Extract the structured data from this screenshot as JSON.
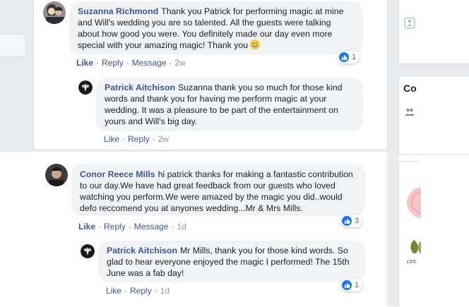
{
  "comments": [
    {
      "author": "Suzanna Richmond",
      "text": "Thank you Patrick for performing magic at mine and Will's wedding you are so talented. All the guests were talking about how good you were. You definitely made our day even more special with your amazing magic! Thank you",
      "emoji": "smiling-face-emoji",
      "actions": {
        "like": "Like",
        "reply": "Reply",
        "message": "Message",
        "time": "2w"
      },
      "reaction_count": "1",
      "reply": {
        "author": "Patrick Aitchison",
        "text": "Suzanna thank you so much for those kind words and thank you for having me perform magic at your wedding. It was a pleasure to be part of the entertainment on yours and Will's big day.",
        "actions": {
          "like": "Like",
          "reply": "Reply",
          "time": "2w"
        }
      }
    },
    {
      "author": "Conor Reece Mills",
      "text": "hi patrick thanks for making a fantastic contribution to our day.We have had great feedback from our guests who loved watching you perform.We were amazed by the magic you did..would defo reccomend you at anyones wedding...Mr & Mrs Mills.",
      "actions": {
        "like": "Like",
        "reply": "Reply",
        "message": "Message",
        "time": "1d"
      },
      "reaction_count": "3",
      "reply": {
        "author": "Patrick Aitchison",
        "text": "Mr Mills, thank you for those kind words. So glad to hear everyone enjoyed the magic I performed! The 15th June was a fab day!",
        "actions": {
          "like": "Like",
          "reply": "Reply",
          "time": "1d"
        },
        "reaction_count": "1"
      }
    }
  ],
  "right_column": {
    "heading_partial": "Co",
    "logo_text_partial": "ces"
  },
  "colors": {
    "link": "#385898",
    "bubble": "#f2f3f5",
    "page_bg": "#e9ebee",
    "like_blue": "#1877f2"
  }
}
